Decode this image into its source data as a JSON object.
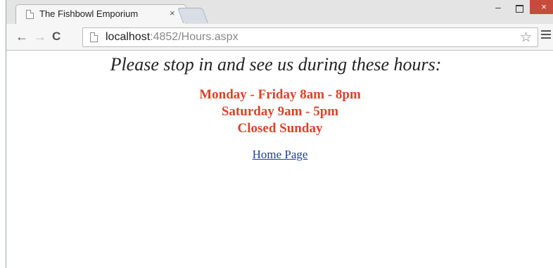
{
  "browser": {
    "tab": {
      "title": "The Fishbowl Emporium",
      "close": "×"
    },
    "window_controls": {
      "minimize": "–",
      "close": "×"
    },
    "url_host": "localhost",
    "url_path": ":4852/Hours.aspx",
    "nav": {
      "back": "←",
      "forward": "→",
      "reload": "C"
    },
    "star": "☆"
  },
  "page": {
    "headline": "Please stop in and see us during these hours:",
    "hours": [
      "Monday - Friday 8am - 8pm",
      "Saturday 9am - 5pm",
      "Closed Sunday"
    ],
    "home_link": "Home Page"
  },
  "colors": {
    "hours_text": "#d9432a",
    "link": "#1f3f8f",
    "close_button": "#c74b3d"
  }
}
